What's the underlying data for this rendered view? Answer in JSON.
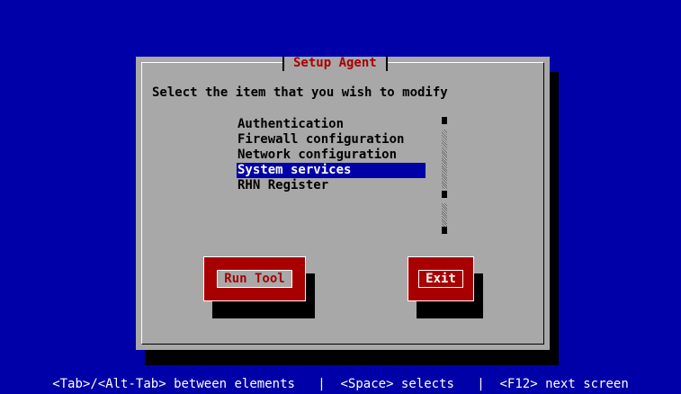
{
  "colors": {
    "background": "#0000a8",
    "dialog": "#a8a8a8",
    "accent": "#a80000",
    "selection": "#0000a8",
    "shadow": "#000000"
  },
  "dialog": {
    "title": "Setup Agent",
    "prompt": "Select the item that you wish to modify"
  },
  "list": {
    "items": [
      {
        "label": "Authentication",
        "selected": false
      },
      {
        "label": "Firewall configuration",
        "selected": false
      },
      {
        "label": "Network configuration",
        "selected": false
      },
      {
        "label": "System services",
        "selected": true
      },
      {
        "label": "RHN Register",
        "selected": false
      }
    ]
  },
  "buttons": {
    "run_tool": "Run Tool",
    "exit": "Exit"
  },
  "status_bar": {
    "text": "<Tab>/<Alt-Tab> between elements   |  <Space> selects   |  <F12> next screen"
  }
}
